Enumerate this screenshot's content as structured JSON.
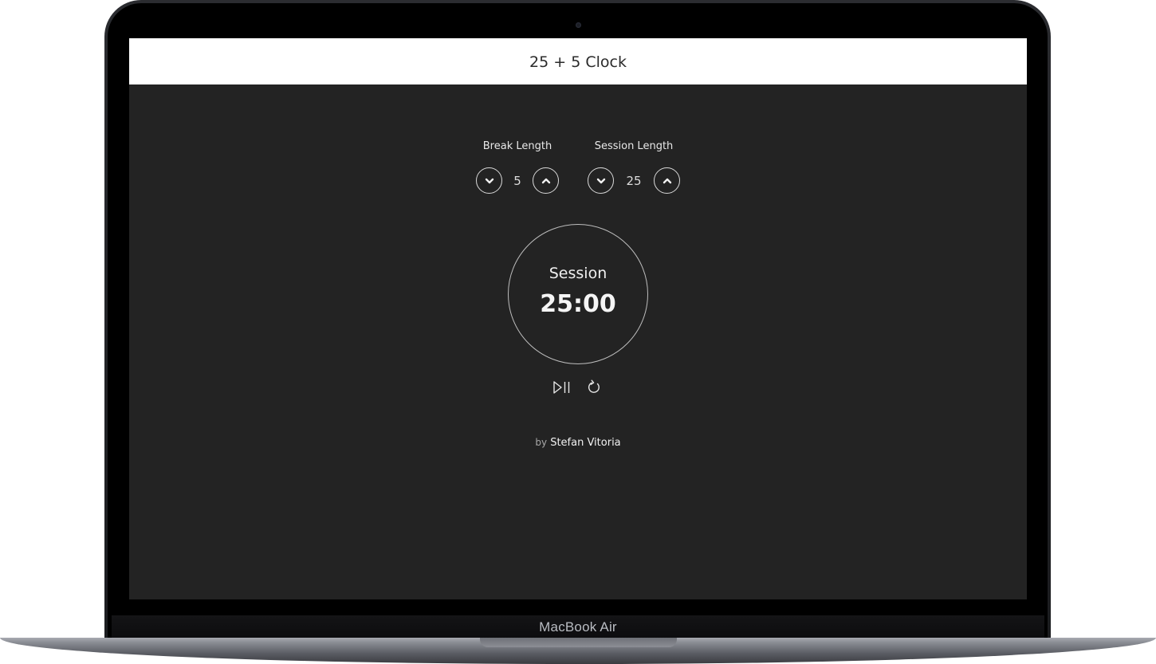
{
  "device": {
    "model_label": "MacBook Air"
  },
  "app": {
    "title": "25 + 5 Clock"
  },
  "break_length": {
    "label": "Break Length",
    "value": "5",
    "decrement_icon": "chevron-down-icon",
    "increment_icon": "chevron-up-icon"
  },
  "session_length": {
    "label": "Session Length",
    "value": "25",
    "decrement_icon": "chevron-down-icon",
    "increment_icon": "chevron-up-icon"
  },
  "timer": {
    "label": "Session",
    "time": "25:00"
  },
  "playback": {
    "play_pause_icon": "play-pause-icon",
    "reset_icon": "refresh-icon"
  },
  "footer": {
    "by": "by",
    "author": "Stefan Vitoria"
  },
  "colors": {
    "background": "#232323",
    "header": "#ffffff",
    "text": "#f0f0f0"
  }
}
